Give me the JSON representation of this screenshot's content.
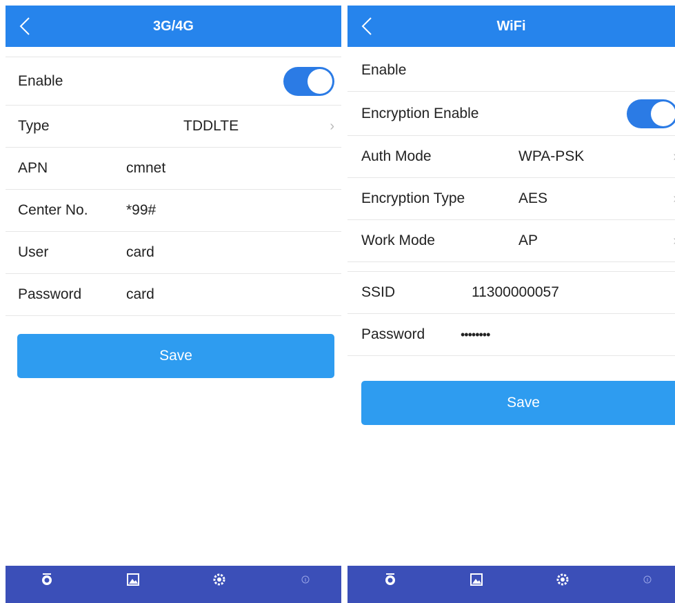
{
  "left_screen": {
    "title": "3G/4G",
    "enable_label": "Enable",
    "type_label": "Type",
    "type_value": "TDDLTE",
    "apn_label": "APN",
    "apn_value": "cmnet",
    "center_label": "Center No.",
    "center_value": "*99#",
    "user_label": "User",
    "user_value": "card",
    "password_label": "Password",
    "password_value": "card",
    "save_label": "Save",
    "enable_on": true
  },
  "right_screen": {
    "title": "WiFi",
    "enable_label": "Enable",
    "encryption_enable_label": "Encryption Enable",
    "encryption_enable_on": true,
    "auth_mode_label": "Auth Mode",
    "auth_mode_value": "WPA-PSK",
    "encryption_type_label": "Encryption Type",
    "encryption_type_value": "AES",
    "work_mode_label": "Work Mode",
    "work_mode_value": "AP",
    "ssid_label": "SSID",
    "ssid_value": "11300000057",
    "password_label": "Password",
    "password_value": "••••••••",
    "save_label": "Save"
  },
  "chevron": "›",
  "tabbar": {
    "icons": [
      "camera-icon",
      "gallery-icon",
      "settings-icon",
      "info-icon"
    ]
  },
  "colors": {
    "header": "#2684ec",
    "toggle": "#2b7be5",
    "save_button": "#2e9cf0",
    "tabbar": "#3b4fb8"
  }
}
